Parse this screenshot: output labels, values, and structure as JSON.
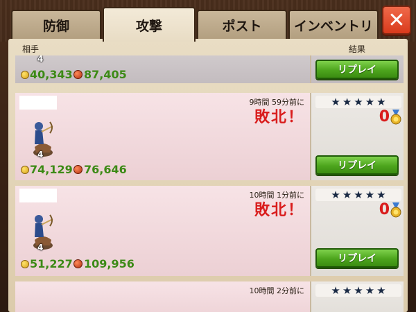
{
  "tabs": [
    {
      "label": "防御"
    },
    {
      "label": "攻撃"
    },
    {
      "label": "ポスト"
    },
    {
      "label": "インベントリ"
    }
  ],
  "active_tab": "攻撃",
  "close_label": "✕",
  "columns": {
    "opponent": "相手",
    "result": "結果"
  },
  "replay_label": "リプレイ",
  "rows": [
    {
      "level": "4",
      "gold": "40,343",
      "elixir": "87,405"
    },
    {
      "time": "9時間 59分前に",
      "result": "敗北！",
      "level": "4",
      "gold": "74,129",
      "elixir": "76,646",
      "medals": "0"
    },
    {
      "time": "10時間 1分前に",
      "result": "敗北！",
      "level": "4",
      "gold": "51,227",
      "elixir": "109,956",
      "medals": "0"
    },
    {
      "time": "10時間 2分前に"
    }
  ]
}
